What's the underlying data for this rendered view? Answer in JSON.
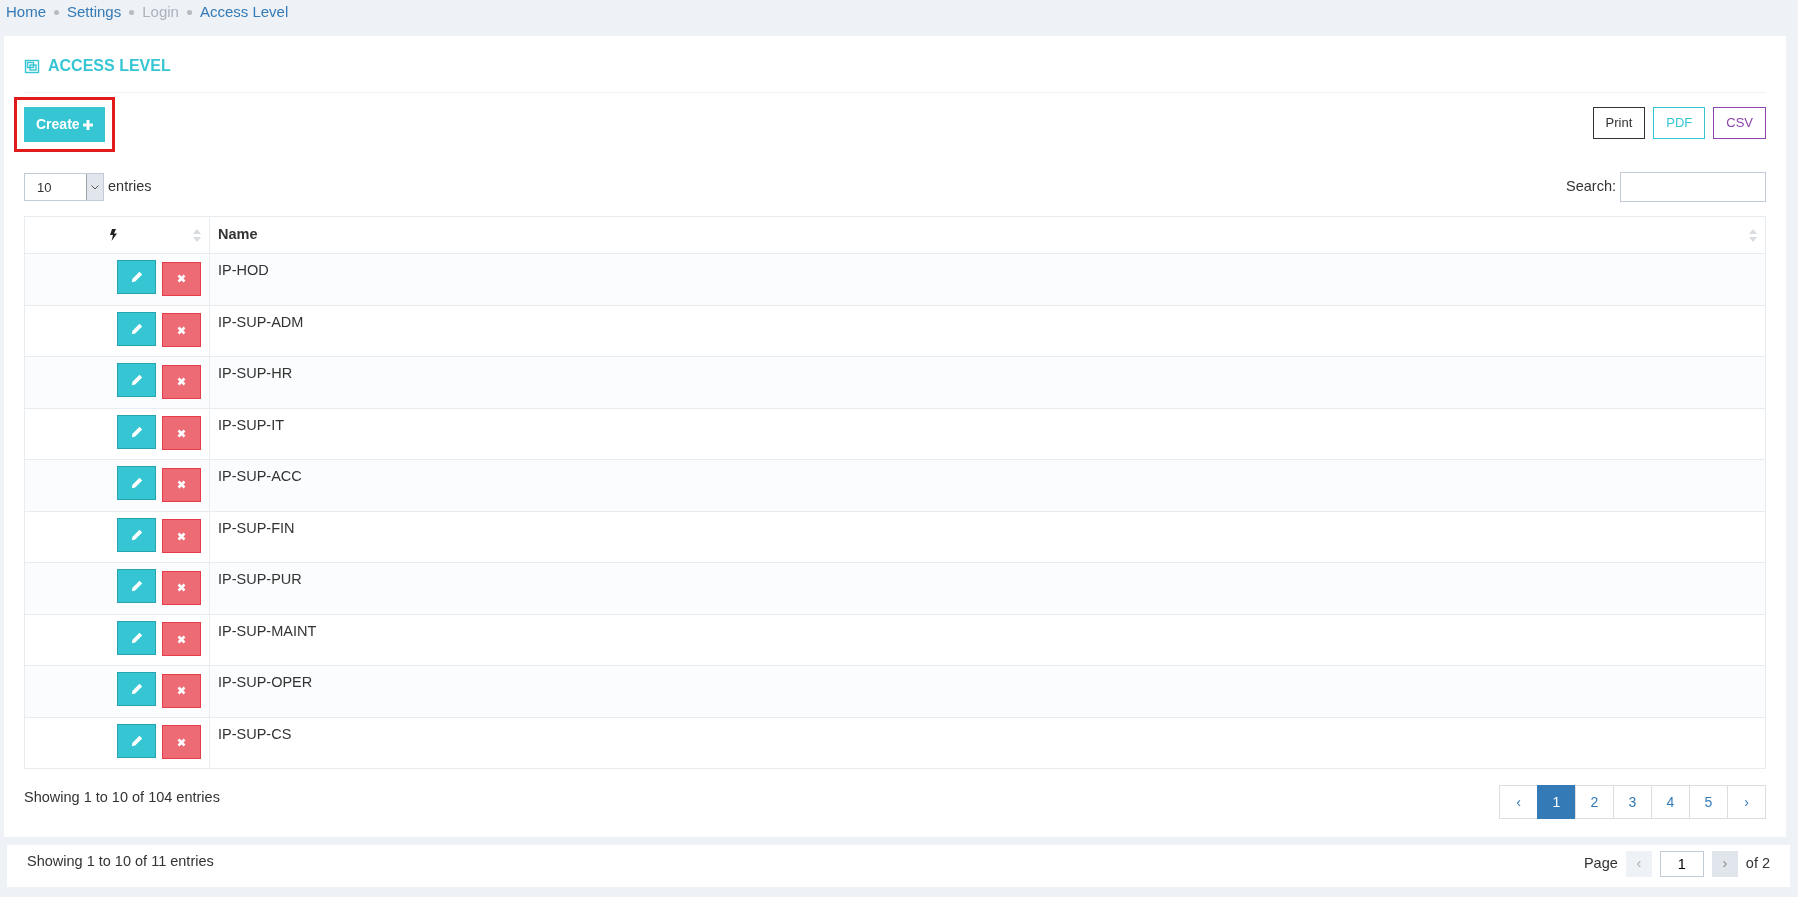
{
  "breadcrumb": [
    {
      "label": "Home",
      "disabled": false
    },
    {
      "label": "Settings",
      "disabled": false
    },
    {
      "label": "Login",
      "disabled": true
    },
    {
      "label": "Access Level",
      "disabled": false
    }
  ],
  "panel": {
    "title": "ACCESS LEVEL",
    "create_button": {
      "label": "Create",
      "highlighted": true
    },
    "export_buttons": [
      {
        "label": "Print",
        "color": "#333333"
      },
      {
        "label": "PDF",
        "color": "#36c6d3"
      },
      {
        "label": "CSV",
        "color": "#8e44ad"
      }
    ],
    "page_length": {
      "value": "10",
      "label": "entries"
    },
    "search": {
      "label": "Search:"
    },
    "table": {
      "columns": [
        {
          "kind": "actions",
          "sortable": true
        },
        {
          "kind": "text",
          "label": "Name",
          "sortable": true
        }
      ],
      "rows": [
        {
          "name": "IP-HOD"
        },
        {
          "name": "IP-SUP-ADM"
        },
        {
          "name": "IP-SUP-HR"
        },
        {
          "name": "IP-SUP-IT"
        },
        {
          "name": "IP-SUP-ACC"
        },
        {
          "name": "IP-SUP-FIN"
        },
        {
          "name": "IP-SUP-PUR"
        },
        {
          "name": "IP-SUP-MAINT"
        },
        {
          "name": "IP-SUP-OPER"
        },
        {
          "name": "IP-SUP-CS"
        }
      ]
    },
    "info": "Showing 1 to 10 of 104 entries",
    "pagination": [
      {
        "label": "‹",
        "selected": false
      },
      {
        "label": "1",
        "selected": true
      },
      {
        "label": "2",
        "selected": false
      },
      {
        "label": "3",
        "selected": false
      },
      {
        "label": "4",
        "selected": false
      },
      {
        "label": "5",
        "selected": false
      },
      {
        "label": "›",
        "selected": false
      }
    ]
  },
  "footer_panel": {
    "info": "Showing 1 to 10 of 11 entries",
    "page_label": "Page",
    "prev": "‹",
    "page_value": "1",
    "next": "›",
    "of_label": "of 2"
  }
}
